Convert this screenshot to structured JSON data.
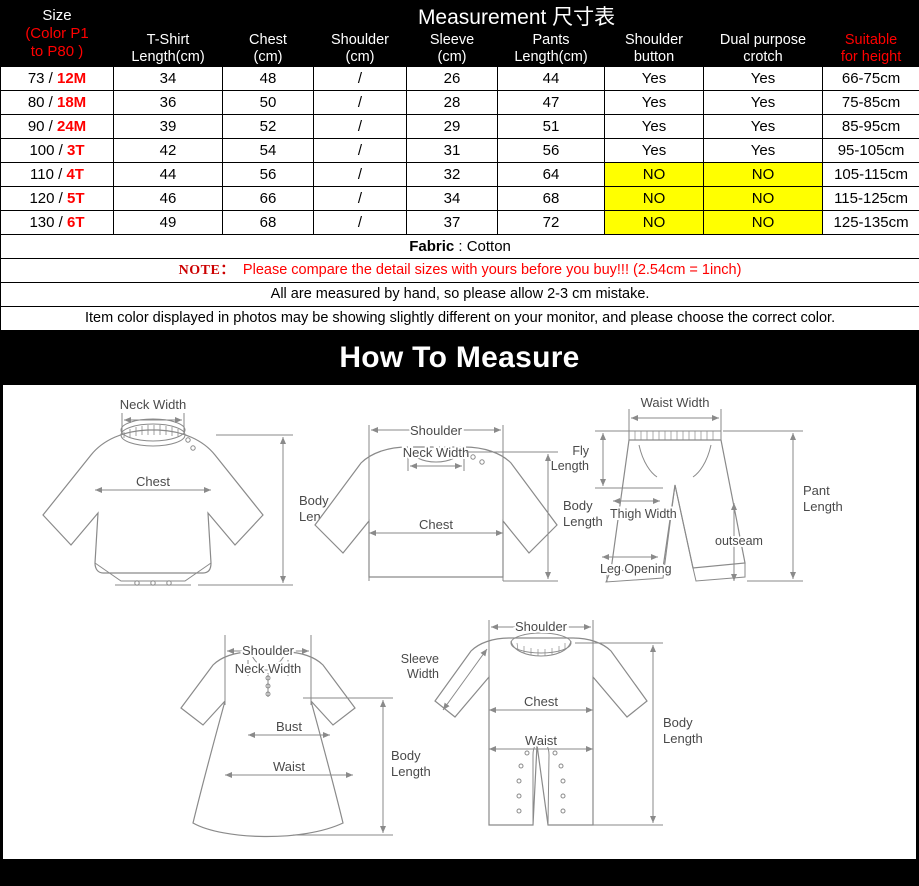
{
  "table": {
    "header": {
      "size_line1": "Size",
      "size_line2": "(Color P1",
      "size_line3": "to P80 )",
      "measurement_title": "Measurement 尺寸表",
      "columns": [
        {
          "l1": "T-Shirt",
          "l2": "Length(cm)",
          "red": false
        },
        {
          "l1": "Chest",
          "l2": "(cm)",
          "red": false
        },
        {
          "l1": "Shoulder",
          "l2": "(cm)",
          "red": false
        },
        {
          "l1": "Sleeve",
          "l2": "(cm)",
          "red": false
        },
        {
          "l1": "Pants",
          "l2": "Length(cm)",
          "red": false
        },
        {
          "l1": "Shoulder",
          "l2": "button",
          "red": false
        },
        {
          "l1": "Dual purpose",
          "l2": "crotch",
          "red": false
        },
        {
          "l1": "Suitable",
          "l2": "for height",
          "red": true
        }
      ]
    },
    "rows": [
      {
        "size_num": "73 / ",
        "size_age": "12M",
        "tshirt": "34",
        "chest": "48",
        "shoulder": "/",
        "sleeve": "26",
        "pants": "44",
        "button": "Yes",
        "crotch": "Yes",
        "height": "66-75cm",
        "highlight": false
      },
      {
        "size_num": "80 / ",
        "size_age": "18M",
        "tshirt": "36",
        "chest": "50",
        "shoulder": "/",
        "sleeve": "28",
        "pants": "47",
        "button": "Yes",
        "crotch": "Yes",
        "height": "75-85cm",
        "highlight": false
      },
      {
        "size_num": "90 / ",
        "size_age": "24M",
        "tshirt": "39",
        "chest": "52",
        "shoulder": "/",
        "sleeve": "29",
        "pants": "51",
        "button": "Yes",
        "crotch": "Yes",
        "height": "85-95cm",
        "highlight": false
      },
      {
        "size_num": "100 / ",
        "size_age": "3T",
        "tshirt": "42",
        "chest": "54",
        "shoulder": "/",
        "sleeve": "31",
        "pants": "56",
        "button": "Yes",
        "crotch": "Yes",
        "height": "95-105cm",
        "highlight": false
      },
      {
        "size_num": "110 / ",
        "size_age": "4T",
        "tshirt": "44",
        "chest": "56",
        "shoulder": "/",
        "sleeve": "32",
        "pants": "64",
        "button": "NO",
        "crotch": "NO",
        "height": "105-115cm",
        "highlight": true
      },
      {
        "size_num": "120 / ",
        "size_age": "5T",
        "tshirt": "46",
        "chest": "66",
        "shoulder": "/",
        "sleeve": "34",
        "pants": "68",
        "button": "NO",
        "crotch": "NO",
        "height": "115-125cm",
        "highlight": true
      },
      {
        "size_num": "130 / ",
        "size_age": "6T",
        "tshirt": "49",
        "chest": "68",
        "shoulder": "/",
        "sleeve": "37",
        "pants": "72",
        "button": "NO",
        "crotch": "NO",
        "height": "125-135cm",
        "highlight": true
      }
    ],
    "notes": {
      "fabric_label": "Fabric",
      "fabric_value": " : Cotton",
      "note_tag": "NOTE：",
      "note_text": "Please compare the detail sizes with yours before you buy!!! (2.54cm = 1inch)",
      "note_measure": "All are measured by hand, so please allow 2-3 cm mistake.",
      "note_color": "Item color displayed in photos may be showing slightly different on your monitor, and please choose the correct color."
    }
  },
  "band": {
    "title": "How To Measure"
  },
  "diagrams": [
    {
      "name": "bodysuit",
      "labels": {
        "neck_width": "Neck Width",
        "chest": "Chest",
        "body_length_l1": "Body",
        "body_length_l2": "Length"
      }
    },
    {
      "name": "sweater",
      "labels": {
        "shoulder": "Shoulder",
        "neck_width": "Neck Width",
        "chest": "Chest",
        "body_length_l1": "Body",
        "body_length_l2": "Length"
      }
    },
    {
      "name": "pants",
      "labels": {
        "waist_width": "Waist Width",
        "fly_length_l1": "Fly",
        "fly_length_l2": "Length",
        "thigh_width": "Thigh Width",
        "leg_opening": "Leg Opening",
        "outseam": "outseam",
        "pant_length_l1": "Pant",
        "pant_length_l2": "Length"
      }
    },
    {
      "name": "dress",
      "labels": {
        "shoulder": "Shoulder",
        "neck_width": "Neck Width",
        "bust": "Bust",
        "waist": "Waist",
        "body_length_l1": "Body",
        "body_length_l2": "Length"
      }
    },
    {
      "name": "romper",
      "labels": {
        "shoulder": "Shoulder",
        "sleeve_width_l1": "Sleeve",
        "sleeve_width_l2": "Width",
        "chest": "Chest",
        "waist": "Waist",
        "body_length_l1": "Body",
        "body_length_l2": "Length"
      }
    }
  ],
  "colors": {
    "accent_red": "#ff0000",
    "highlight_yellow": "#ffff00",
    "header_black": "#000000",
    "line_gray": "#8a8a8a"
  }
}
